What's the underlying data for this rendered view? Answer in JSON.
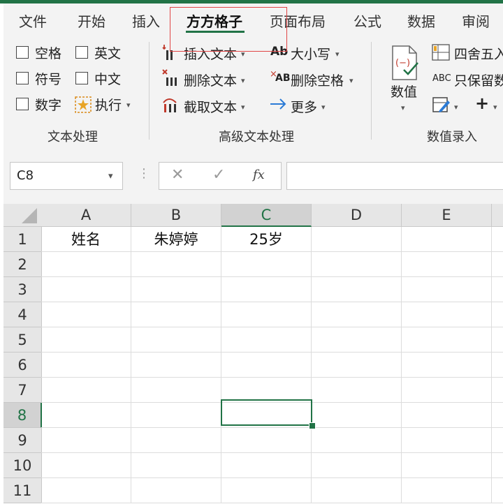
{
  "tabs": [
    "文件",
    "开始",
    "插入",
    "方方格子",
    "页面布局",
    "公式",
    "数据",
    "审阅"
  ],
  "active_tab": "方方格子",
  "ribbon": {
    "text_processing": {
      "label": "文本处理",
      "checkboxes": [
        "空格",
        "英文",
        "符号",
        "中文",
        "数字"
      ],
      "execute": "执行"
    },
    "advanced_text": {
      "label": "高级文本处理",
      "insert_text": "插入文本",
      "delete_text": "删除文本",
      "extract_text": "截取文本",
      "case": "大小写",
      "delete_spaces": "删除空格",
      "more": "更多",
      "case_icon_text": "Ab",
      "delete_spaces_icon_text": "AB"
    },
    "numeric_entry": {
      "label": "数值录入",
      "numeric_button": "数值",
      "round": "四舍五入",
      "keep_numbers": "只保留数",
      "abc_icon_text": "ABC"
    }
  },
  "formula_bar": {
    "name_box": "C8",
    "fx": "fx",
    "formula": ""
  },
  "sheet": {
    "columns": [
      "A",
      "B",
      "C",
      "D",
      "E"
    ],
    "rows": [
      "1",
      "2",
      "3",
      "4",
      "5",
      "6",
      "7",
      "8",
      "9",
      "10",
      "11"
    ],
    "selected_column": "C",
    "selected_row": "8",
    "cells": {
      "A1": "姓名",
      "B1": "朱婷婷",
      "C1": "25岁"
    }
  },
  "colors": {
    "accent": "#217346",
    "highlight_box": "#e04545"
  }
}
